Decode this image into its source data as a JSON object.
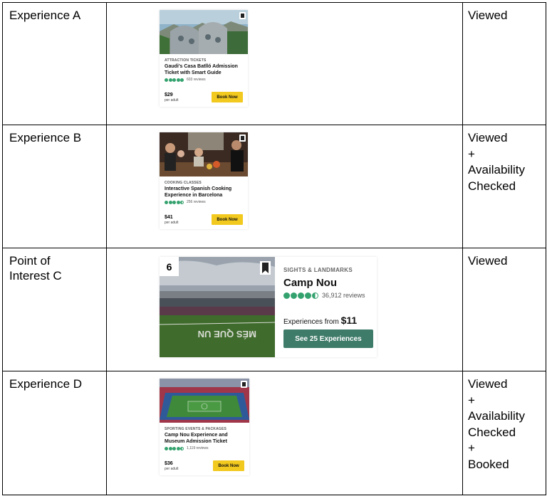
{
  "rows": [
    {
      "label": "Experience A",
      "status": [
        "Viewed"
      ],
      "card": {
        "category": "ATTRACTION TICKETS",
        "title": "Gaudi's Casa Batlló Admission Ticket with Smart Guide",
        "rating": 5,
        "reviews": "603 reviews",
        "price": "$29",
        "per": "per adult",
        "button": "Book Now"
      }
    },
    {
      "label": "Experience B",
      "status": [
        "Viewed",
        "+",
        "Availability",
        "Checked"
      ],
      "card": {
        "category": "COOKING CLASSES",
        "title": "Interactive Spanish Cooking Experience in Barcelona",
        "rating": 4.5,
        "reviews": "256 reviews",
        "price": "$41",
        "per": "per adult",
        "button": "Book Now"
      }
    },
    {
      "label": "Point of Interest C",
      "label_lines": [
        "Point of",
        "Interest C"
      ],
      "status": [
        "Viewed"
      ],
      "poi": {
        "rank": "6",
        "category": "SIGHTS & LANDMARKS",
        "name": "Camp Nou",
        "rating": 4.5,
        "reviews": "36,912 reviews",
        "from_text": "Experiences from",
        "from_price": "$11",
        "button": "See 25 Experiences"
      }
    },
    {
      "label": "Experience D",
      "status": [
        "Viewed",
        "+",
        "Availability",
        "Checked",
        "+",
        "Booked"
      ],
      "card": {
        "category": "SPORTING EVENTS & PACKAGES",
        "title": "Camp Nou Experience and Museum Admission Ticket",
        "rating": 4.5,
        "reviews": "1,119 reviews",
        "price": "$36",
        "per": "per adult",
        "button": "Book Now"
      }
    }
  ],
  "colors": {
    "rating_green": "#34a26e",
    "book_yellow": "#f2c91f",
    "see_button_green": "#3f7b69"
  }
}
